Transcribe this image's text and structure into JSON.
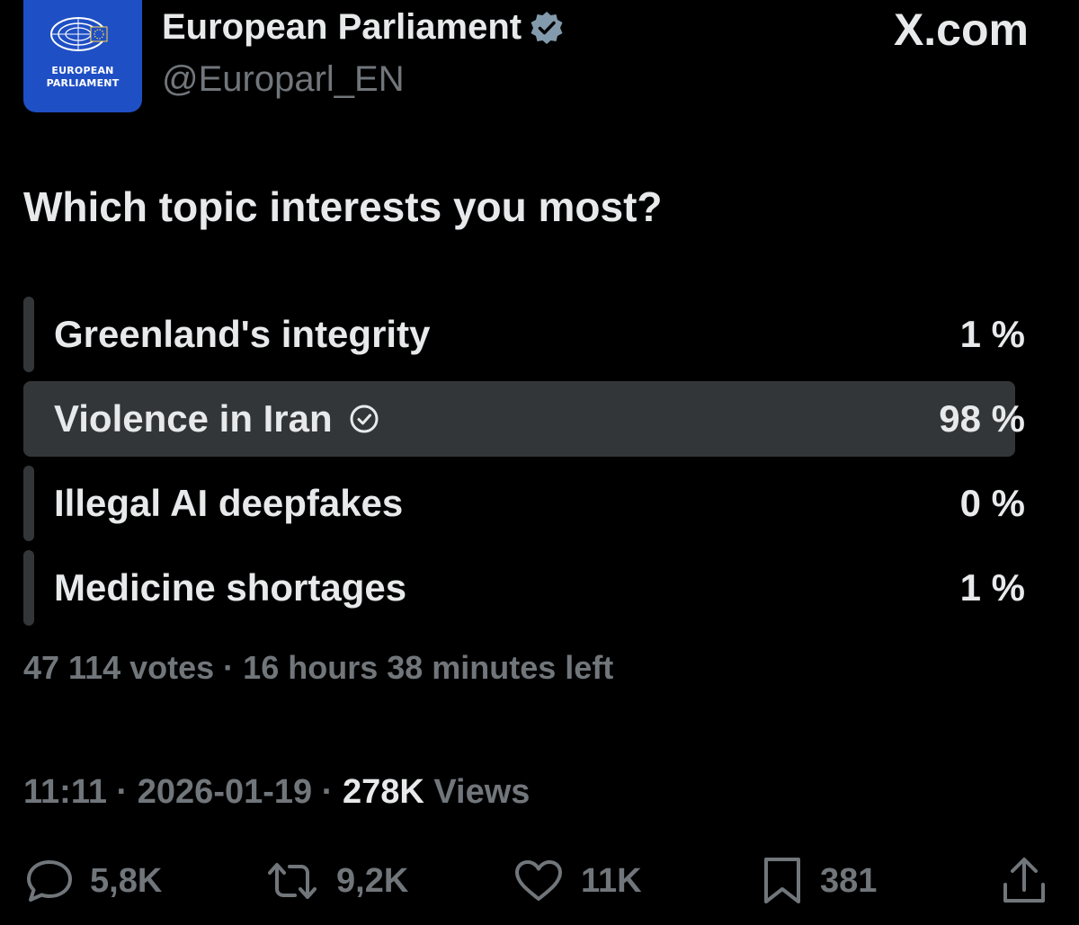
{
  "tweet": {
    "author_name": "European Parliament",
    "handle": "@Europarl_EN",
    "avatar_text_line1": "EUROPEAN",
    "avatar_text_line2": "PARLIAMENT",
    "watermark": "X.com",
    "question": "Which topic interests you most?"
  },
  "poll": {
    "options": [
      {
        "label": "Greenland's integrity",
        "percent_text": "1 %",
        "fraction": 0.01,
        "selected": false
      },
      {
        "label": "Violence in Iran",
        "percent_text": "98 %",
        "fraction": 0.98,
        "selected": true
      },
      {
        "label": "Illegal AI deepfakes",
        "percent_text": "0 %",
        "fraction": 0.0,
        "selected": false
      },
      {
        "label": "Medicine shortages",
        "percent_text": "1 %",
        "fraction": 0.01,
        "selected": false
      }
    ],
    "votes": "47 114 votes",
    "separator": " · ",
    "time_left": "16 hours 38 minutes left"
  },
  "meta": {
    "time": "11:11",
    "separator": " · ",
    "date": "2026-01-19",
    "views_count": "278K",
    "views_label": "Views"
  },
  "actions": {
    "replies": "5,8K",
    "reposts": "9,2K",
    "likes": "11K",
    "bookmarks": "381"
  },
  "colors": {
    "background": "#000000",
    "primary_text": "#e7e9ea",
    "secondary_text": "#71767b",
    "poll_bar": "#333639",
    "verified_badge": "#829aab",
    "avatar_blue": "#1f4fc4"
  },
  "icons": {
    "verified": "verified-badge-icon",
    "selected_option": "check-circle-icon",
    "reply": "reply-icon",
    "repost": "repost-icon",
    "like": "heart-icon",
    "bookmark": "bookmark-icon",
    "share": "share-icon"
  }
}
